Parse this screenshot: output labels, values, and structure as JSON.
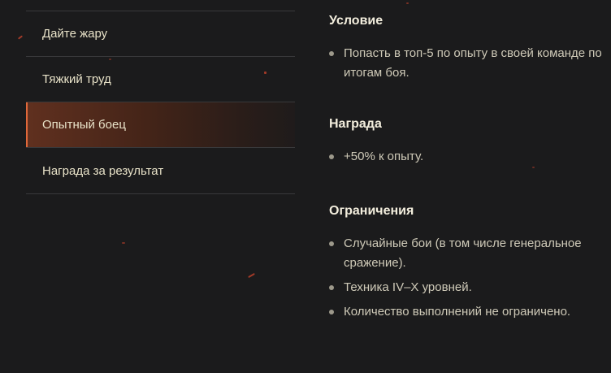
{
  "sidebar": {
    "items": [
      {
        "label": "Дайте жару",
        "active": false
      },
      {
        "label": "Тяжкий труд",
        "active": false
      },
      {
        "label": "Опытный боец",
        "active": true
      },
      {
        "label": "Награда за результат",
        "active": false
      }
    ]
  },
  "content": {
    "condition": {
      "title": "Условие",
      "items": [
        "Попасть в топ-5 по опыту в своей команде по итогам боя."
      ]
    },
    "reward": {
      "title": "Награда",
      "items": [
        "+50% к опыту."
      ]
    },
    "restrictions": {
      "title": "Ограничения",
      "items": [
        "Случайные бои (в том числе генеральное сражение).",
        "Техника IV–X уровней.",
        "Количество выполнений не ограничено."
      ]
    }
  },
  "colors": {
    "background": "#1b1b1c",
    "accent": "#e0683a",
    "active_bg": "#60301f",
    "text": "#e9e3c9",
    "body_text": "#cfcab8"
  }
}
